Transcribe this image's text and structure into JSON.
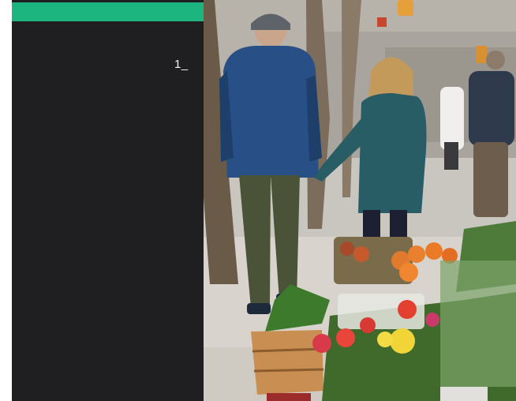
{
  "page": {
    "marker": "1_"
  },
  "colors": {
    "accent": "#1cb580",
    "panel": "#1f1f21",
    "marker_text": "#f2f2f2"
  },
  "photo": {
    "subject": "couple-walking-past-flower-market"
  }
}
